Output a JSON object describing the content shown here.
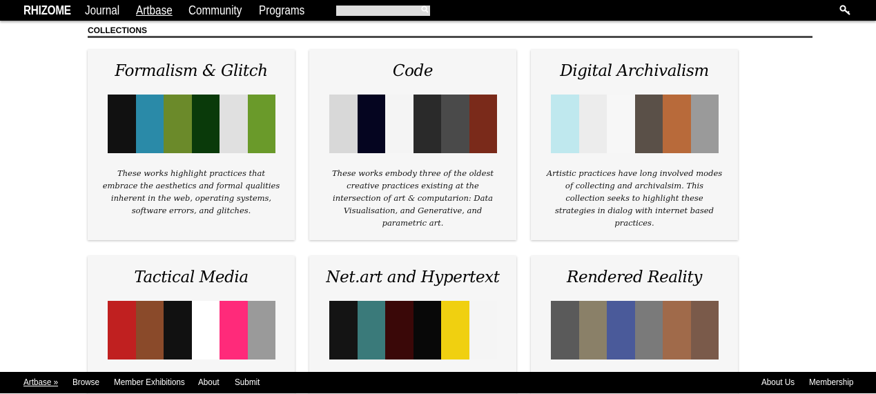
{
  "topnav": {
    "brand": "RHIZOME",
    "items": [
      "Journal",
      "Artbase",
      "Community",
      "Programs"
    ],
    "active": "Artbase",
    "search_placeholder": ""
  },
  "section_title": "COLLECTIONS",
  "cards": [
    {
      "title": "Formalism & Glitch",
      "description": "These works highlight practices that embrace the aesthetics and formal qualities inherent in the web, operating systems, software errors, and glitches.",
      "thumb_colors": [
        "#111111",
        "#2a8aa8",
        "#6b8a2a",
        "#0a3a0a",
        "#e0e0e0",
        "#6a9a2a"
      ]
    },
    {
      "title": "Code",
      "description": "These works embody three of the oldest creative practices existing at the intersection of art & computarion: Data Visualisation, and Generative, and parametric art.",
      "thumb_colors": [
        "#d8d8d8",
        "#050520",
        "#f4f4f4",
        "#2a2a2a",
        "#4a4a4a",
        "#7a2a1a"
      ]
    },
    {
      "title": "Digital Archivalism",
      "description": "Artistic practices have long involved modes of collecting and archivalsim. This collection seeks to highlight these strategies in dialog with internet based practices.",
      "thumb_colors": [
        "#bfe8ee",
        "#ececec",
        "#f7f7f7",
        "#5a5048",
        "#b86a3a",
        "#9a9a9a"
      ]
    },
    {
      "title": "Tactical Media",
      "description": "",
      "thumb_colors": [
        "#c02020",
        "#8a4a2a",
        "#111111",
        "#ffffff",
        "#ff2a7a",
        "#9a9a9a"
      ]
    },
    {
      "title": "Net.art and Hypertext",
      "description": "",
      "thumb_colors": [
        "#141414",
        "#3a7a7a",
        "#3a0808",
        "#080808",
        "#f0d010",
        "#f5f5f5"
      ]
    },
    {
      "title": "Rendered Reality",
      "description": "",
      "thumb_colors": [
        "#5a5a5a",
        "#8a8068",
        "#4a5a9a",
        "#7a7a7a",
        "#a06a4a",
        "#7a5a4a"
      ]
    }
  ],
  "bottomnav": {
    "left": [
      "Artbase »",
      "Browse",
      "Member Exhibitions",
      "About",
      "Submit"
    ],
    "right": [
      "About Us",
      "Membership"
    ]
  }
}
